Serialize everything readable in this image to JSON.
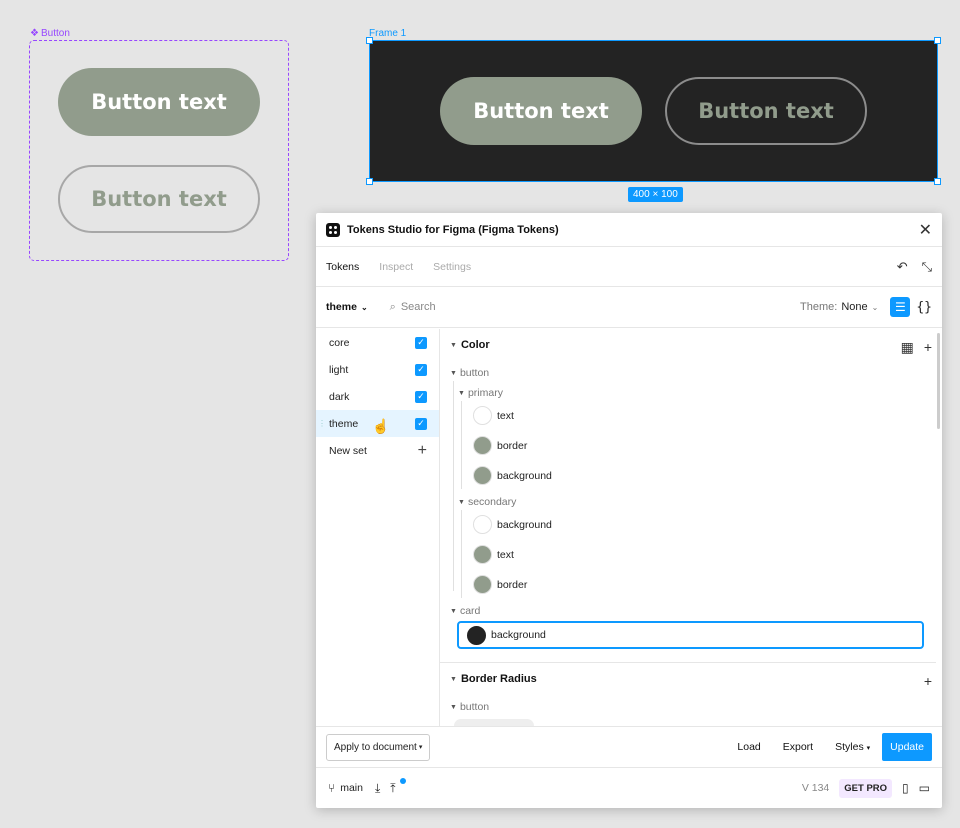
{
  "canvas": {
    "component_label": "Button",
    "component_buttons": [
      "Button text",
      "Button text"
    ],
    "frame_label": "Frame 1",
    "frame_buttons": [
      "Button text",
      "Button text"
    ],
    "frame_size": "400 × 100"
  },
  "plugin": {
    "title": "Tokens Studio for Figma (Figma Tokens)",
    "tabs": [
      "Tokens",
      "Inspect",
      "Settings"
    ],
    "active_tab": "Tokens",
    "token_set_select": "theme",
    "search_placeholder": "Search",
    "theme_label": "Theme:",
    "theme_value": "None",
    "sets": [
      {
        "label": "core",
        "checked": true
      },
      {
        "label": "light",
        "checked": true
      },
      {
        "label": "dark",
        "checked": true
      },
      {
        "label": "theme",
        "checked": true,
        "selected": true
      },
      {
        "label": "New set"
      }
    ],
    "groups": {
      "color": {
        "title": "Color",
        "button": {
          "label": "button",
          "primary": {
            "label": "primary",
            "tokens": [
              {
                "name": "text",
                "color": "#ffffff"
              },
              {
                "name": "border",
                "color": "#919c8c"
              },
              {
                "name": "background",
                "color": "#919c8c"
              }
            ]
          },
          "secondary": {
            "label": "secondary",
            "tokens": [
              {
                "name": "background",
                "color": "#ffffff"
              },
              {
                "name": "text",
                "color": "#919c8c"
              },
              {
                "name": "border",
                "color": "#919c8c"
              }
            ]
          }
        },
        "card": {
          "label": "card",
          "token": {
            "name": "background",
            "color": "#232323"
          }
        }
      },
      "border_radius": {
        "title": "Border Radius",
        "button_label": "button"
      }
    },
    "footer": {
      "apply": "Apply to document",
      "load": "Load",
      "export": "Export",
      "styles": "Styles",
      "update": "Update"
    },
    "status": {
      "branch": "main",
      "version": "V 134",
      "get_pro": "GET PRO"
    }
  },
  "colors": {
    "accent": "#0d99ff",
    "component": "#9747ff",
    "sage": "#919c8c",
    "dark": "#232323"
  }
}
